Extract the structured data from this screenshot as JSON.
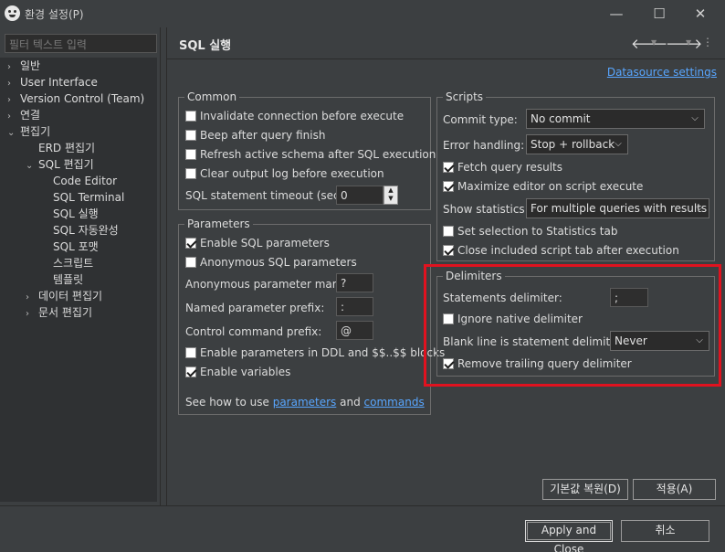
{
  "window": {
    "title": "환경 설정(P)",
    "minimize_icon": "minimize-icon",
    "maximize_icon": "maximize-icon",
    "close_icon": "close-icon"
  },
  "filter": {
    "placeholder": "필터 텍스트 입력"
  },
  "tree": {
    "items": [
      {
        "label": "일반",
        "arrow": "›"
      },
      {
        "label": "User Interface",
        "arrow": "›"
      },
      {
        "label": "Version Control (Team)",
        "arrow": "›"
      },
      {
        "label": "연결",
        "arrow": "›"
      },
      {
        "label": "편집기",
        "arrow": "⌄"
      },
      {
        "label": "ERD 편집기",
        "arrow": ""
      },
      {
        "label": "SQL 편집기",
        "arrow": "⌄"
      },
      {
        "label": "Code Editor",
        "arrow": ""
      },
      {
        "label": "SQL Terminal",
        "arrow": ""
      },
      {
        "label": "SQL 실행",
        "arrow": ""
      },
      {
        "label": "SQL 자동완성",
        "arrow": ""
      },
      {
        "label": "SQL 포맷",
        "arrow": ""
      },
      {
        "label": "스크립트",
        "arrow": ""
      },
      {
        "label": "템플릿",
        "arrow": ""
      },
      {
        "label": "데이터 편집기",
        "arrow": "›"
      },
      {
        "label": "문서 편집기",
        "arrow": "›"
      }
    ]
  },
  "page": {
    "title": "SQL 실행",
    "back_icon": "back-arrow-icon",
    "forward_icon": "forward-arrow-icon",
    "datasource_link": "Datasource settings"
  },
  "common": {
    "title": "Common",
    "invalidate": {
      "label": "Invalidate connection before execute",
      "checked": false
    },
    "beep": {
      "label": "Beep after query finish",
      "checked": false
    },
    "refresh_schema": {
      "label": "Refresh active schema after SQL execution",
      "checked": false
    },
    "clear_log": {
      "label": "Clear output log before execution",
      "checked": false
    },
    "timeout_label": "SQL statement timeout (sec):",
    "timeout_value": "0"
  },
  "parameters": {
    "title": "Parameters",
    "enable_sql_params": {
      "label": "Enable SQL parameters",
      "checked": true
    },
    "anonymous_params": {
      "label": "Anonymous SQL parameters",
      "checked": false
    },
    "anon_mark_label": "Anonymous parameter mark:",
    "anon_mark_value": "?",
    "named_prefix_label": "Named parameter prefix:",
    "named_prefix_value": ":",
    "control_prefix_label": "Control command prefix:",
    "control_prefix_value": "@",
    "ddl_params": {
      "label": "Enable parameters in DDL and $$..$$ blocks",
      "checked": false
    },
    "enable_variables": {
      "label": "Enable variables",
      "checked": true
    },
    "see_how": "See how to use",
    "parameters_link": "parameters",
    "and_text": "and",
    "commands_link": "commands"
  },
  "scripts": {
    "title": "Scripts",
    "commit_type_label": "Commit type:",
    "commit_type_value": "No commit",
    "error_handling_label": "Error handling:",
    "error_handling_value": "Stop + rollback",
    "fetch_results": {
      "label": "Fetch query results",
      "checked": true
    },
    "maximize_editor": {
      "label": "Maximize editor on script execute",
      "checked": true
    },
    "show_stats_label": "Show statistics:",
    "show_stats_value": "For multiple queries with results",
    "set_selection": {
      "label": "Set selection to Statistics tab",
      "checked": false
    },
    "close_tab": {
      "label": "Close included script tab after execution",
      "checked": true
    }
  },
  "delimiters": {
    "title": "Delimiters",
    "statements_label": "Statements delimiter:",
    "statements_value": ";",
    "ignore_native": {
      "label": "Ignore native delimiter",
      "checked": false
    },
    "blank_line_label": "Blank line is statement delimiter:",
    "blank_line_value": "Never",
    "remove_trailing": {
      "label": "Remove trailing query delimiter",
      "checked": true
    },
    "highlight_color": "#e0121f"
  },
  "buttons": {
    "restore_defaults": "기본값 복원(D)",
    "apply": "적용(A)",
    "apply_close": "Apply and Close",
    "cancel": "취소"
  },
  "colors": {
    "background": "#3c3f41",
    "link": "#58a6ff"
  }
}
